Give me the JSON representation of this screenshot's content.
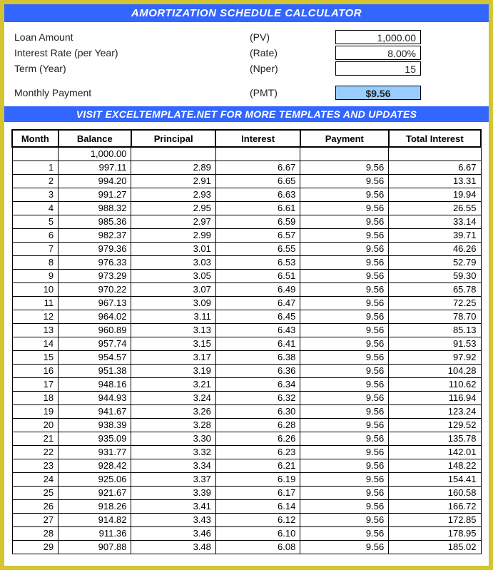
{
  "title": "AMORTIZATION SCHEDULE CALCULATOR",
  "inputs": {
    "loan_amount_label": "Loan Amount",
    "loan_amount_abbr": "(PV)",
    "loan_amount_value": "1,000.00",
    "rate_label": "Interest Rate (per Year)",
    "rate_abbr": "(Rate)",
    "rate_value": "8.00%",
    "term_label": "Term (Year)",
    "term_abbr": "(Nper)",
    "term_value": "15",
    "pmt_label": "Monthly Payment",
    "pmt_abbr": "(PMT)",
    "pmt_value": "$9.56"
  },
  "banner": "VISIT EXCELTEMPLATE.NET FOR MORE TEMPLATES AND UPDATES",
  "table": {
    "headers": [
      "Month",
      "Balance",
      "Principal",
      "Interest",
      "Payment",
      "Total Interest"
    ],
    "initial_balance": "1,000.00",
    "rows": [
      {
        "month": "1",
        "balance": "997.11",
        "principal": "2.89",
        "interest": "6.67",
        "payment": "9.56",
        "total": "6.67"
      },
      {
        "month": "2",
        "balance": "994.20",
        "principal": "2.91",
        "interest": "6.65",
        "payment": "9.56",
        "total": "13.31"
      },
      {
        "month": "3",
        "balance": "991.27",
        "principal": "2.93",
        "interest": "6.63",
        "payment": "9.56",
        "total": "19.94"
      },
      {
        "month": "4",
        "balance": "988.32",
        "principal": "2.95",
        "interest": "6.61",
        "payment": "9.56",
        "total": "26.55"
      },
      {
        "month": "5",
        "balance": "985.36",
        "principal": "2.97",
        "interest": "6.59",
        "payment": "9.56",
        "total": "33.14"
      },
      {
        "month": "6",
        "balance": "982.37",
        "principal": "2.99",
        "interest": "6.57",
        "payment": "9.56",
        "total": "39.71"
      },
      {
        "month": "7",
        "balance": "979.36",
        "principal": "3.01",
        "interest": "6.55",
        "payment": "9.56",
        "total": "46.26"
      },
      {
        "month": "8",
        "balance": "976.33",
        "principal": "3.03",
        "interest": "6.53",
        "payment": "9.56",
        "total": "52.79"
      },
      {
        "month": "9",
        "balance": "973.29",
        "principal": "3.05",
        "interest": "6.51",
        "payment": "9.56",
        "total": "59.30"
      },
      {
        "month": "10",
        "balance": "970.22",
        "principal": "3.07",
        "interest": "6.49",
        "payment": "9.56",
        "total": "65.78"
      },
      {
        "month": "11",
        "balance": "967.13",
        "principal": "3.09",
        "interest": "6.47",
        "payment": "9.56",
        "total": "72.25"
      },
      {
        "month": "12",
        "balance": "964.02",
        "principal": "3.11",
        "interest": "6.45",
        "payment": "9.56",
        "total": "78.70"
      },
      {
        "month": "13",
        "balance": "960.89",
        "principal": "3.13",
        "interest": "6.43",
        "payment": "9.56",
        "total": "85.13"
      },
      {
        "month": "14",
        "balance": "957.74",
        "principal": "3.15",
        "interest": "6.41",
        "payment": "9.56",
        "total": "91.53"
      },
      {
        "month": "15",
        "balance": "954.57",
        "principal": "3.17",
        "interest": "6.38",
        "payment": "9.56",
        "total": "97.92"
      },
      {
        "month": "16",
        "balance": "951.38",
        "principal": "3.19",
        "interest": "6.36",
        "payment": "9.56",
        "total": "104.28"
      },
      {
        "month": "17",
        "balance": "948.16",
        "principal": "3.21",
        "interest": "6.34",
        "payment": "9.56",
        "total": "110.62"
      },
      {
        "month": "18",
        "balance": "944.93",
        "principal": "3.24",
        "interest": "6.32",
        "payment": "9.56",
        "total": "116.94"
      },
      {
        "month": "19",
        "balance": "941.67",
        "principal": "3.26",
        "interest": "6.30",
        "payment": "9.56",
        "total": "123.24"
      },
      {
        "month": "20",
        "balance": "938.39",
        "principal": "3.28",
        "interest": "6.28",
        "payment": "9.56",
        "total": "129.52"
      },
      {
        "month": "21",
        "balance": "935.09",
        "principal": "3.30",
        "interest": "6.26",
        "payment": "9.56",
        "total": "135.78"
      },
      {
        "month": "22",
        "balance": "931.77",
        "principal": "3.32",
        "interest": "6.23",
        "payment": "9.56",
        "total": "142.01"
      },
      {
        "month": "23",
        "balance": "928.42",
        "principal": "3.34",
        "interest": "6.21",
        "payment": "9.56",
        "total": "148.22"
      },
      {
        "month": "24",
        "balance": "925.06",
        "principal": "3.37",
        "interest": "6.19",
        "payment": "9.56",
        "total": "154.41"
      },
      {
        "month": "25",
        "balance": "921.67",
        "principal": "3.39",
        "interest": "6.17",
        "payment": "9.56",
        "total": "160.58"
      },
      {
        "month": "26",
        "balance": "918.26",
        "principal": "3.41",
        "interest": "6.14",
        "payment": "9.56",
        "total": "166.72"
      },
      {
        "month": "27",
        "balance": "914.82",
        "principal": "3.43",
        "interest": "6.12",
        "payment": "9.56",
        "total": "172.85"
      },
      {
        "month": "28",
        "balance": "911.36",
        "principal": "3.46",
        "interest": "6.10",
        "payment": "9.56",
        "total": "178.95"
      },
      {
        "month": "29",
        "balance": "907.88",
        "principal": "3.48",
        "interest": "6.08",
        "payment": "9.56",
        "total": "185.02"
      }
    ]
  }
}
